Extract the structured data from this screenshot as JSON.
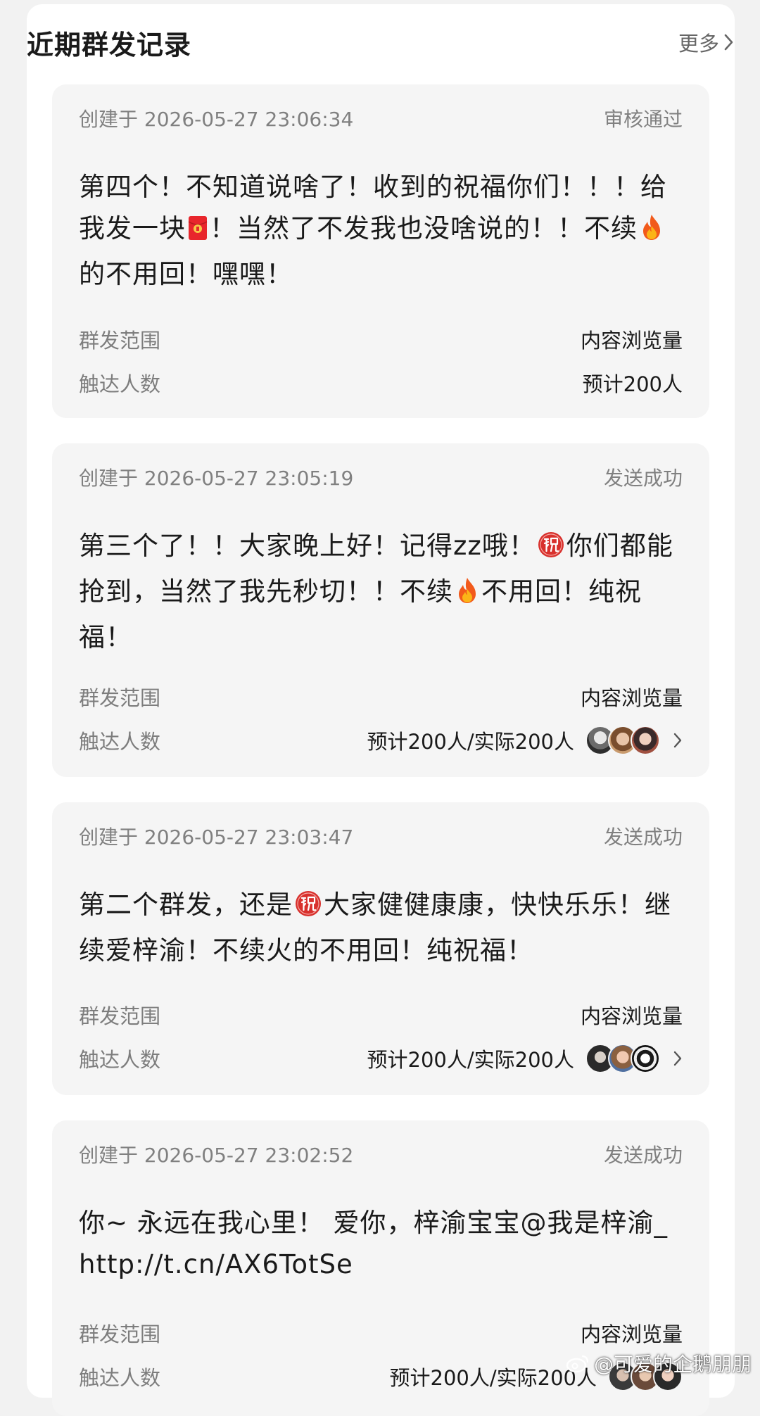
{
  "header": {
    "title": "近期群发记录",
    "more_label": "更多"
  },
  "records": [
    {
      "created": "创建于 2026-05-27 23:06:34",
      "status": "审核通过",
      "body": [
        {
          "t": "text",
          "v": "第四个！不知道说啥了！收到的祝福你们！！！给我发一块"
        },
        {
          "t": "icon",
          "icon": "red-envelope-icon"
        },
        {
          "t": "text",
          "v": "！当然了不发我也没啥说的！！不续"
        },
        {
          "t": "icon",
          "icon": "fire-icon"
        },
        {
          "t": "text",
          "v": "的不用回！嘿嘿！"
        }
      ],
      "scope_label": "群发范围",
      "scope_value": "内容浏览量",
      "reach_label": "触达人数",
      "reach_value": "预计200人",
      "has_avatars": false
    },
    {
      "created": "创建于 2026-05-27 23:05:19",
      "status": "发送成功",
      "body": [
        {
          "t": "text",
          "v": "第三个了！！大家晚上好！记得zz哦！"
        },
        {
          "t": "icon",
          "icon": "zhu-blessing-icon"
        },
        {
          "t": "text",
          "v": "你们都能抢到，当然了我先秒切！！不续"
        },
        {
          "t": "icon",
          "icon": "fire-icon"
        },
        {
          "t": "text",
          "v": "不用回！纯祝福！"
        }
      ],
      "scope_label": "群发范围",
      "scope_value": "内容浏览量",
      "reach_label": "触达人数",
      "reach_value": "预计200人/实际200人",
      "has_avatars": true
    },
    {
      "created": "创建于 2026-05-27 23:03:47",
      "status": "发送成功",
      "body": [
        {
          "t": "text",
          "v": "第二个群发，还是"
        },
        {
          "t": "icon",
          "icon": "zhu-blessing-icon"
        },
        {
          "t": "text",
          "v": "大家健健康康，快快乐乐！继续爱梓渝！不续火的不用回！纯祝福！"
        }
      ],
      "scope_label": "群发范围",
      "scope_value": "内容浏览量",
      "reach_label": "触达人数",
      "reach_value": "预计200人/实际200人",
      "has_avatars": true
    },
    {
      "created": "创建于 2026-05-27 23:02:52",
      "status": "发送成功",
      "body": [
        {
          "t": "text",
          "v": "你~ 永远在我心里！ 爱你，梓渝宝宝@我是梓渝_ http://t.cn/AX6TotSe"
        }
      ],
      "scope_label": "群发范围",
      "scope_value": "内容浏览量",
      "reach_label": "触达人数",
      "reach_value": "预计200人/实际200人",
      "has_avatars": true
    }
  ],
  "watermark": "@可爱的企鹅朋朋",
  "colors": {
    "page_bg": "#f2f2f2",
    "panel_bg": "#ffffff",
    "card_bg": "#f5f5f5",
    "muted_text": "#808080",
    "main_text": "#1a1a1a"
  }
}
